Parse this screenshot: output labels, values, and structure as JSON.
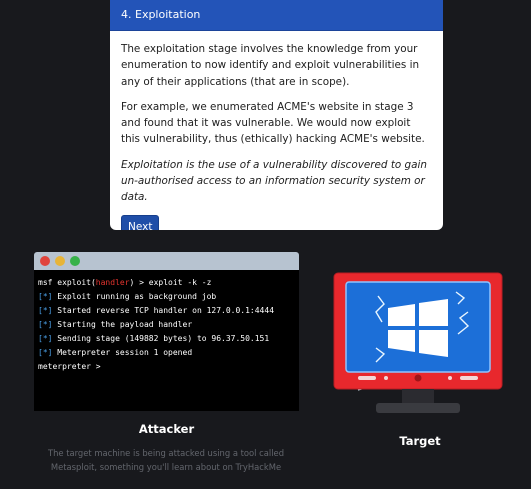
{
  "card": {
    "header": "4. Exploitation",
    "paragraph1": "The exploitation stage involves the knowledge from your enumeration to now identify and exploit vulnerabilities in any of their applications (that are in scope).",
    "paragraph2": "For example, we enumerated ACME's website in stage 3 and found that it was vulnerable. We would now exploit this vulnerability, thus (ethically) hacking ACME's website.",
    "paragraph3": "Exploitation is the use of a vulnerability discovered to gain un-authorised access to an information security system or data.",
    "next_label": "Next"
  },
  "terminal": {
    "line1_prefix": "msf exploit(",
    "line1_module": "handler",
    "line1_suffix": ") > exploit -k -z",
    "marker": "[*]",
    "lines": [
      " Exploit running as background job",
      " Started reverse TCP handler on 127.0.0.1:4444",
      " Starting the payload handler",
      " Sending stage (149882 bytes) to 96.37.50.151",
      " Meterpreter session 1 opened"
    ],
    "prompt": "meterpreter >"
  },
  "attacker": {
    "label": "Attacker",
    "caption": "The target machine is being attacked using a tool called Metasploit, something you'll learn about on TryHackMe"
  },
  "target": {
    "label": "Target"
  },
  "colors": {
    "header_blue": "#2354b8",
    "monitor_red": "#e8282d",
    "screen_blue": "#1c6fd8"
  }
}
